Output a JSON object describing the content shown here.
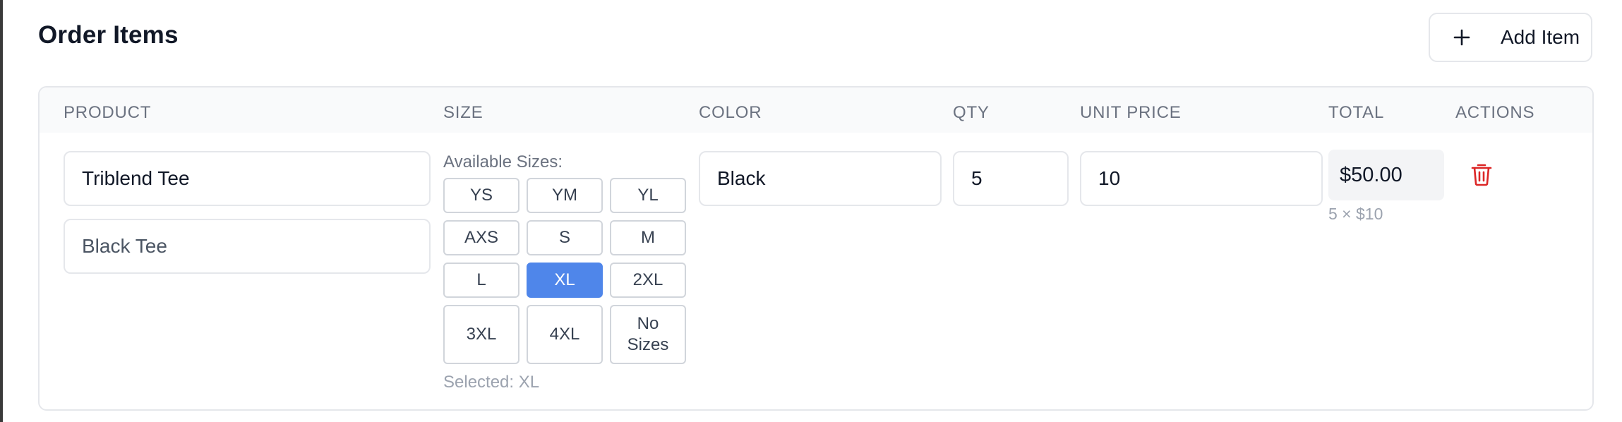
{
  "header": {
    "title": "Order Items",
    "add_item_label": "Add Item",
    "add_icon": "plus-icon"
  },
  "table": {
    "columns": [
      "PRODUCT",
      "SIZE",
      "COLOR",
      "QTY",
      "UNIT PRICE",
      "TOTAL",
      "ACTIONS"
    ],
    "rows": [
      {
        "product_name": "Triblend Tee",
        "product_description": "Black Tee",
        "available_sizes_label": "Available Sizes:",
        "sizes": [
          "YS",
          "YM",
          "YL",
          "AXS",
          "S",
          "M",
          "L",
          "XL",
          "2XL",
          "3XL",
          "4XL",
          "No Sizes"
        ],
        "selected_size": "XL",
        "selected_text": "Selected: XL",
        "color": "Black",
        "qty": "5",
        "unit_price": "10",
        "total": "$50.00",
        "total_breakdown": "5 × $10",
        "delete_icon": "trash-icon"
      }
    ]
  },
  "colors": {
    "accent": "#4f86ea",
    "danger": "#dc2626",
    "border": "#e5e7eb",
    "header_bg": "#f9fafb",
    "muted_text": "#6b7280"
  }
}
